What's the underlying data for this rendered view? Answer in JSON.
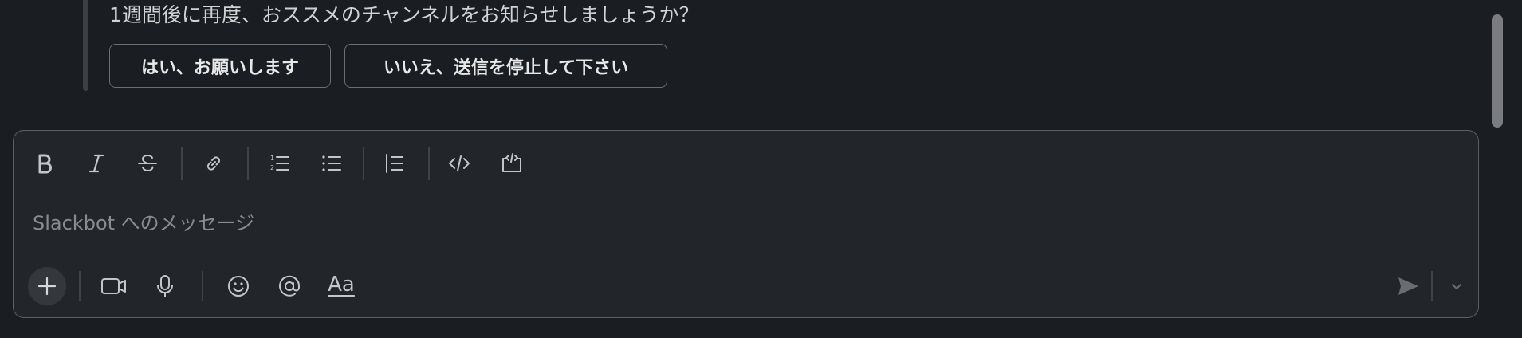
{
  "message": {
    "text": "1週間後に再度、おススメのチャンネルをお知らせしましょうか？",
    "buttons": {
      "yes_label": "はい、お願いします",
      "no_label": "いいえ、送信を停止して下さい"
    }
  },
  "composer": {
    "placeholder": "Slackbot へのメッセージ",
    "toolbar_icons": [
      "bold-icon",
      "italic-icon",
      "strikethrough-icon",
      "link-icon",
      "ordered-list-icon",
      "bulleted-list-icon",
      "blockquote-icon",
      "code-icon",
      "code-block-icon"
    ],
    "bottom_icons": [
      "plus-icon",
      "video-icon",
      "microphone-icon",
      "emoji-icon",
      "mention-icon",
      "text-format-icon",
      "send-icon",
      "chevron-down-icon"
    ],
    "format_label": "Aa"
  },
  "colors": {
    "background": "#1a1d21",
    "composer_bg": "#222529",
    "border": "#5c5f64",
    "text": "#d1d2d3",
    "icon": "#c4c5c7",
    "placeholder": "#8a8b8d"
  }
}
